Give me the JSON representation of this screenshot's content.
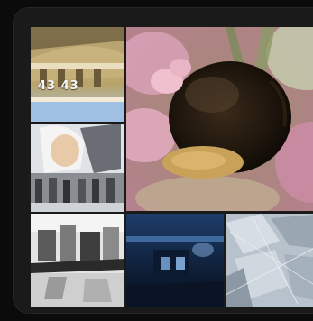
{
  "gallery": {
    "tiles": [
      {
        "id": "building",
        "overlay_text": "43  43"
      },
      {
        "id": "bumblebee"
      },
      {
        "id": "people"
      },
      {
        "id": "bw-street"
      },
      {
        "id": "blue-scene"
      },
      {
        "id": "ice-texture"
      }
    ]
  },
  "colors": {
    "background": "#0b0b0b",
    "panel": "#1a1a1a"
  }
}
